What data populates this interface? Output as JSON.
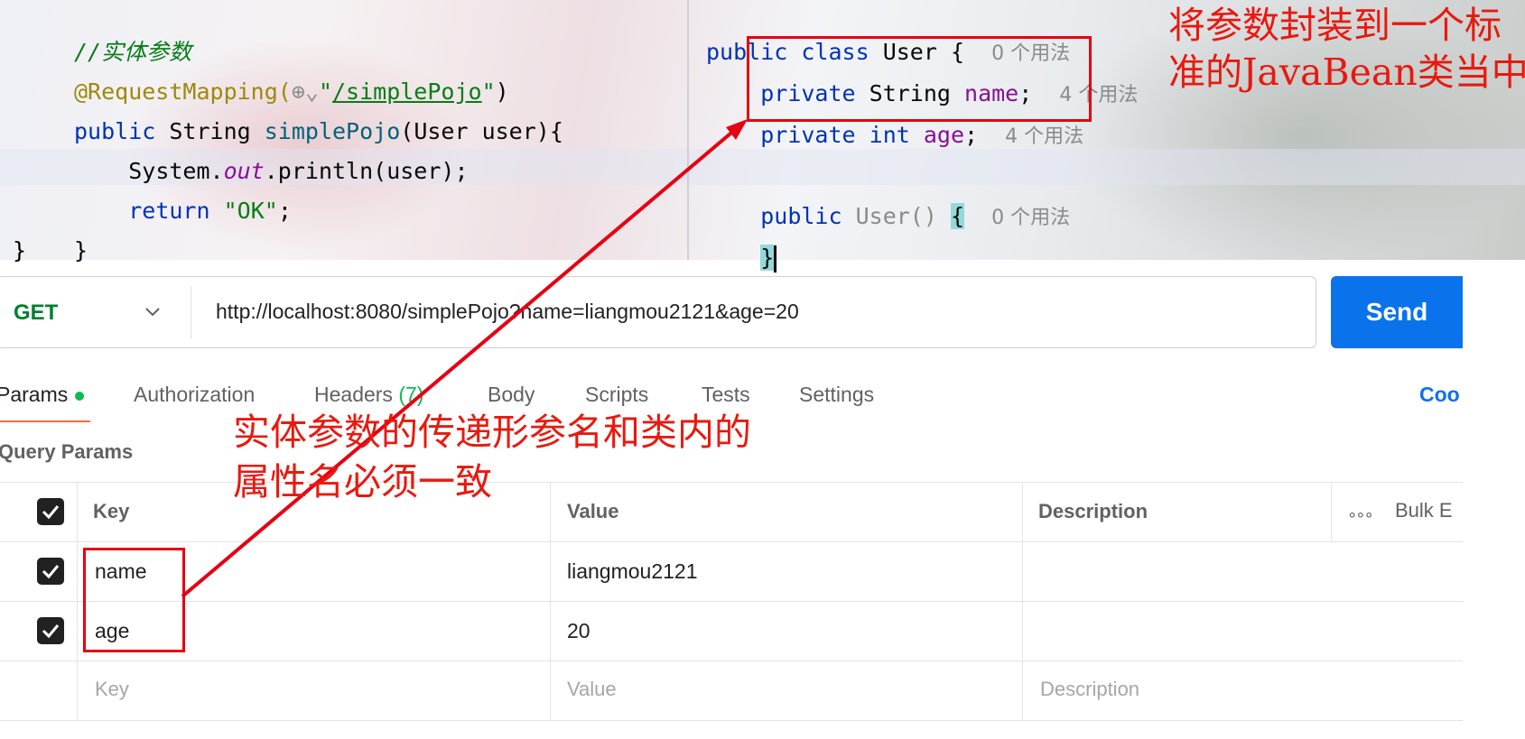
{
  "code_left": {
    "comment": "//实体参数",
    "annotation": "@RequestMapping(",
    "mapping_path": "/simplePojo",
    "line_method_kw": "public",
    "line_method_type": "String",
    "line_method_name": "simplePojo",
    "line_method_params": "(User user){",
    "line_println_obj": "System.",
    "line_println_out": "out",
    "line_println_rest": ".println(user);",
    "line_return_kw": "return",
    "line_return_val": "\"OK\"",
    "line_return_end": ";",
    "close_brace": "}",
    "outer_brace": "}"
  },
  "code_right": {
    "class_kw": "public class",
    "class_name": "User {",
    "class_hint": "0 个用法",
    "field1_kw": "private",
    "field1_type": "String",
    "field1_name": "name",
    "field1_hint": "4 个用法",
    "field2_kw": "private",
    "field2_type": "int",
    "field2_name": "age",
    "field2_hint": "4 个用法",
    "ctor_kw": "public",
    "ctor_name": "User()",
    "ctor_brace": "{",
    "ctor_hint": "0 个用法",
    "ctor_close": "}"
  },
  "request": {
    "method": "GET",
    "url": "http://localhost:8080/simplePojo?name=liangmou2121&age=20",
    "send_label": "Send"
  },
  "tabs": [
    {
      "label": "Params"
    },
    {
      "label": "Authorization"
    },
    {
      "label": "Headers",
      "count": "(7)"
    },
    {
      "label": "Body"
    },
    {
      "label": "Scripts"
    },
    {
      "label": "Tests"
    },
    {
      "label": "Settings"
    }
  ],
  "cookies_label": "Coo",
  "query_params_title": "Query Params",
  "table": {
    "headers": {
      "key": "Key",
      "value": "Value",
      "description": "Description",
      "bulk": "Bulk E"
    },
    "rows": [
      {
        "key": "name",
        "value": "liangmou2121",
        "checked": true
      },
      {
        "key": "age",
        "value": "20",
        "checked": true
      }
    ],
    "placeholders": {
      "key": "Key",
      "value": "Value",
      "description": "Description"
    }
  },
  "annotations": {
    "note_top_right_line1": "将参数封装到一个标",
    "note_top_right_line2": "准的JavaBean类当中",
    "note_middle_line1": "实体参数的传递形参名和类内的",
    "note_middle_line2": "属性名必须一致",
    "color": "#e60012"
  }
}
